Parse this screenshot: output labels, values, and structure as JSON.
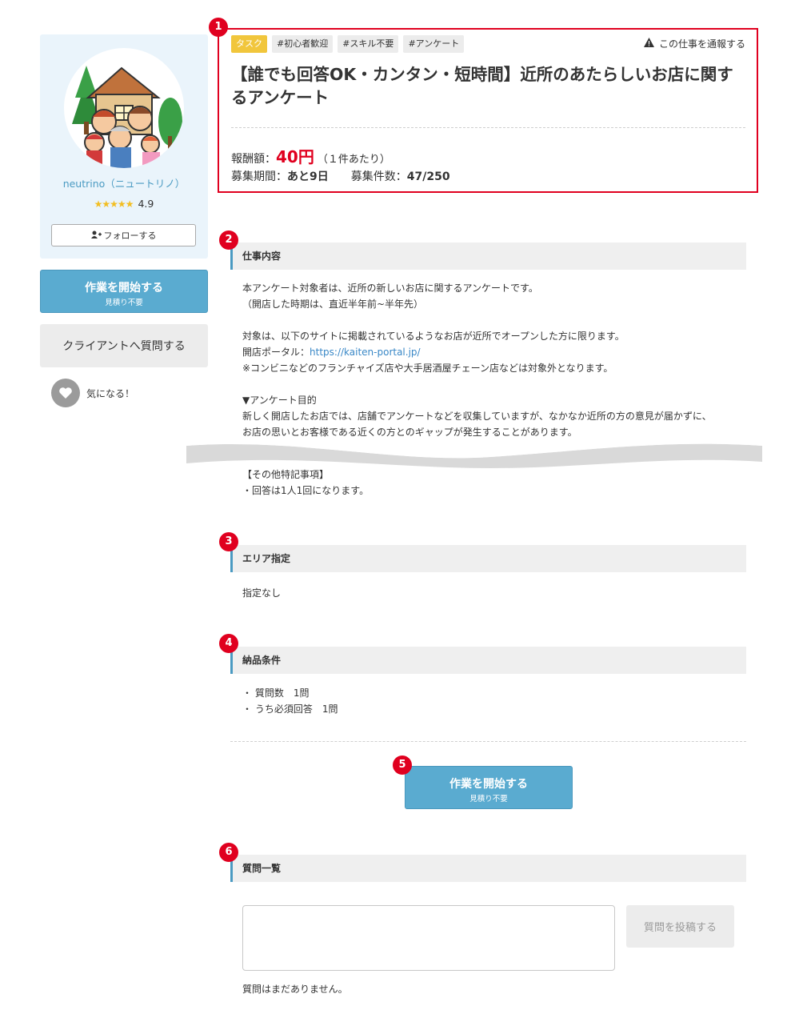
{
  "sidebar": {
    "profile": {
      "name": "neutrino（ニュートリノ）",
      "rating": "4.9",
      "stars": "★★★★★",
      "follow_label": "フォローする"
    },
    "start_button": {
      "label": "作業を開始する",
      "sub": "見積り不要"
    },
    "ask_button": {
      "label": "クライアントへ質問する"
    },
    "favorite": {
      "label": "気になる！"
    }
  },
  "header": {
    "badge": "1",
    "tags": [
      "タスク",
      "#初心者歓迎",
      "#スキル不要",
      "#アンケート"
    ],
    "report_label": "この仕事を通報する",
    "title": "【誰でも回答OK・カンタン・短時間】近所のあたらしいお店に関するアンケート",
    "pay_label": "報酬額：",
    "pay_amount": "40円",
    "pay_unit": "（１件あたり）",
    "period_label": "募集期間：",
    "period_value": "あと9日",
    "count_label": "募集件数：",
    "count_value": "47/250"
  },
  "sections": {
    "job": {
      "badge": "2",
      "title": "仕事内容",
      "lines": [
        "本アンケート対象者は、近所の新しいお店に関するアンケートです。",
        "（開店した時期は、直近半年前~半年先）",
        "",
        "対象は、以下のサイトに掲載されているようなお店が近所でオープンした方に限ります。",
        "開店ポータル：",
        "※コンビニなどのフランチャイズ店や大手居酒屋チェーン店などは対象外となります。",
        "",
        "▼アンケート目的",
        "新しく開店したお店では、店舗でアンケートなどを収集していますが、なかなか近所の方の意見が届かずに、",
        "お店の思いとお客様である近くの方とのギャップが発生することがあります。"
      ],
      "link": "https://kaiten-portal.jp/",
      "extra_lines": [
        "【その他特記事項】",
        "・回答は1人1回になります。"
      ]
    },
    "area": {
      "badge": "3",
      "title": "エリア指定",
      "value": "指定なし"
    },
    "delivery": {
      "badge": "4",
      "title": "納品条件",
      "lines": [
        "・ 質問数　1問",
        "・ うち必須回答　1問"
      ]
    },
    "start_main": {
      "badge": "5",
      "label": "作業を開始する",
      "sub": "見積り不要"
    },
    "questions": {
      "badge": "6",
      "title": "質問一覧",
      "post_label": "質問を投稿する",
      "empty_text": "質問はまだありません。"
    }
  },
  "colors": {
    "accent": "#5aabd0",
    "alert": "#e0001f",
    "tag_task": "#f1c63c",
    "link": "#4a9ac2"
  }
}
